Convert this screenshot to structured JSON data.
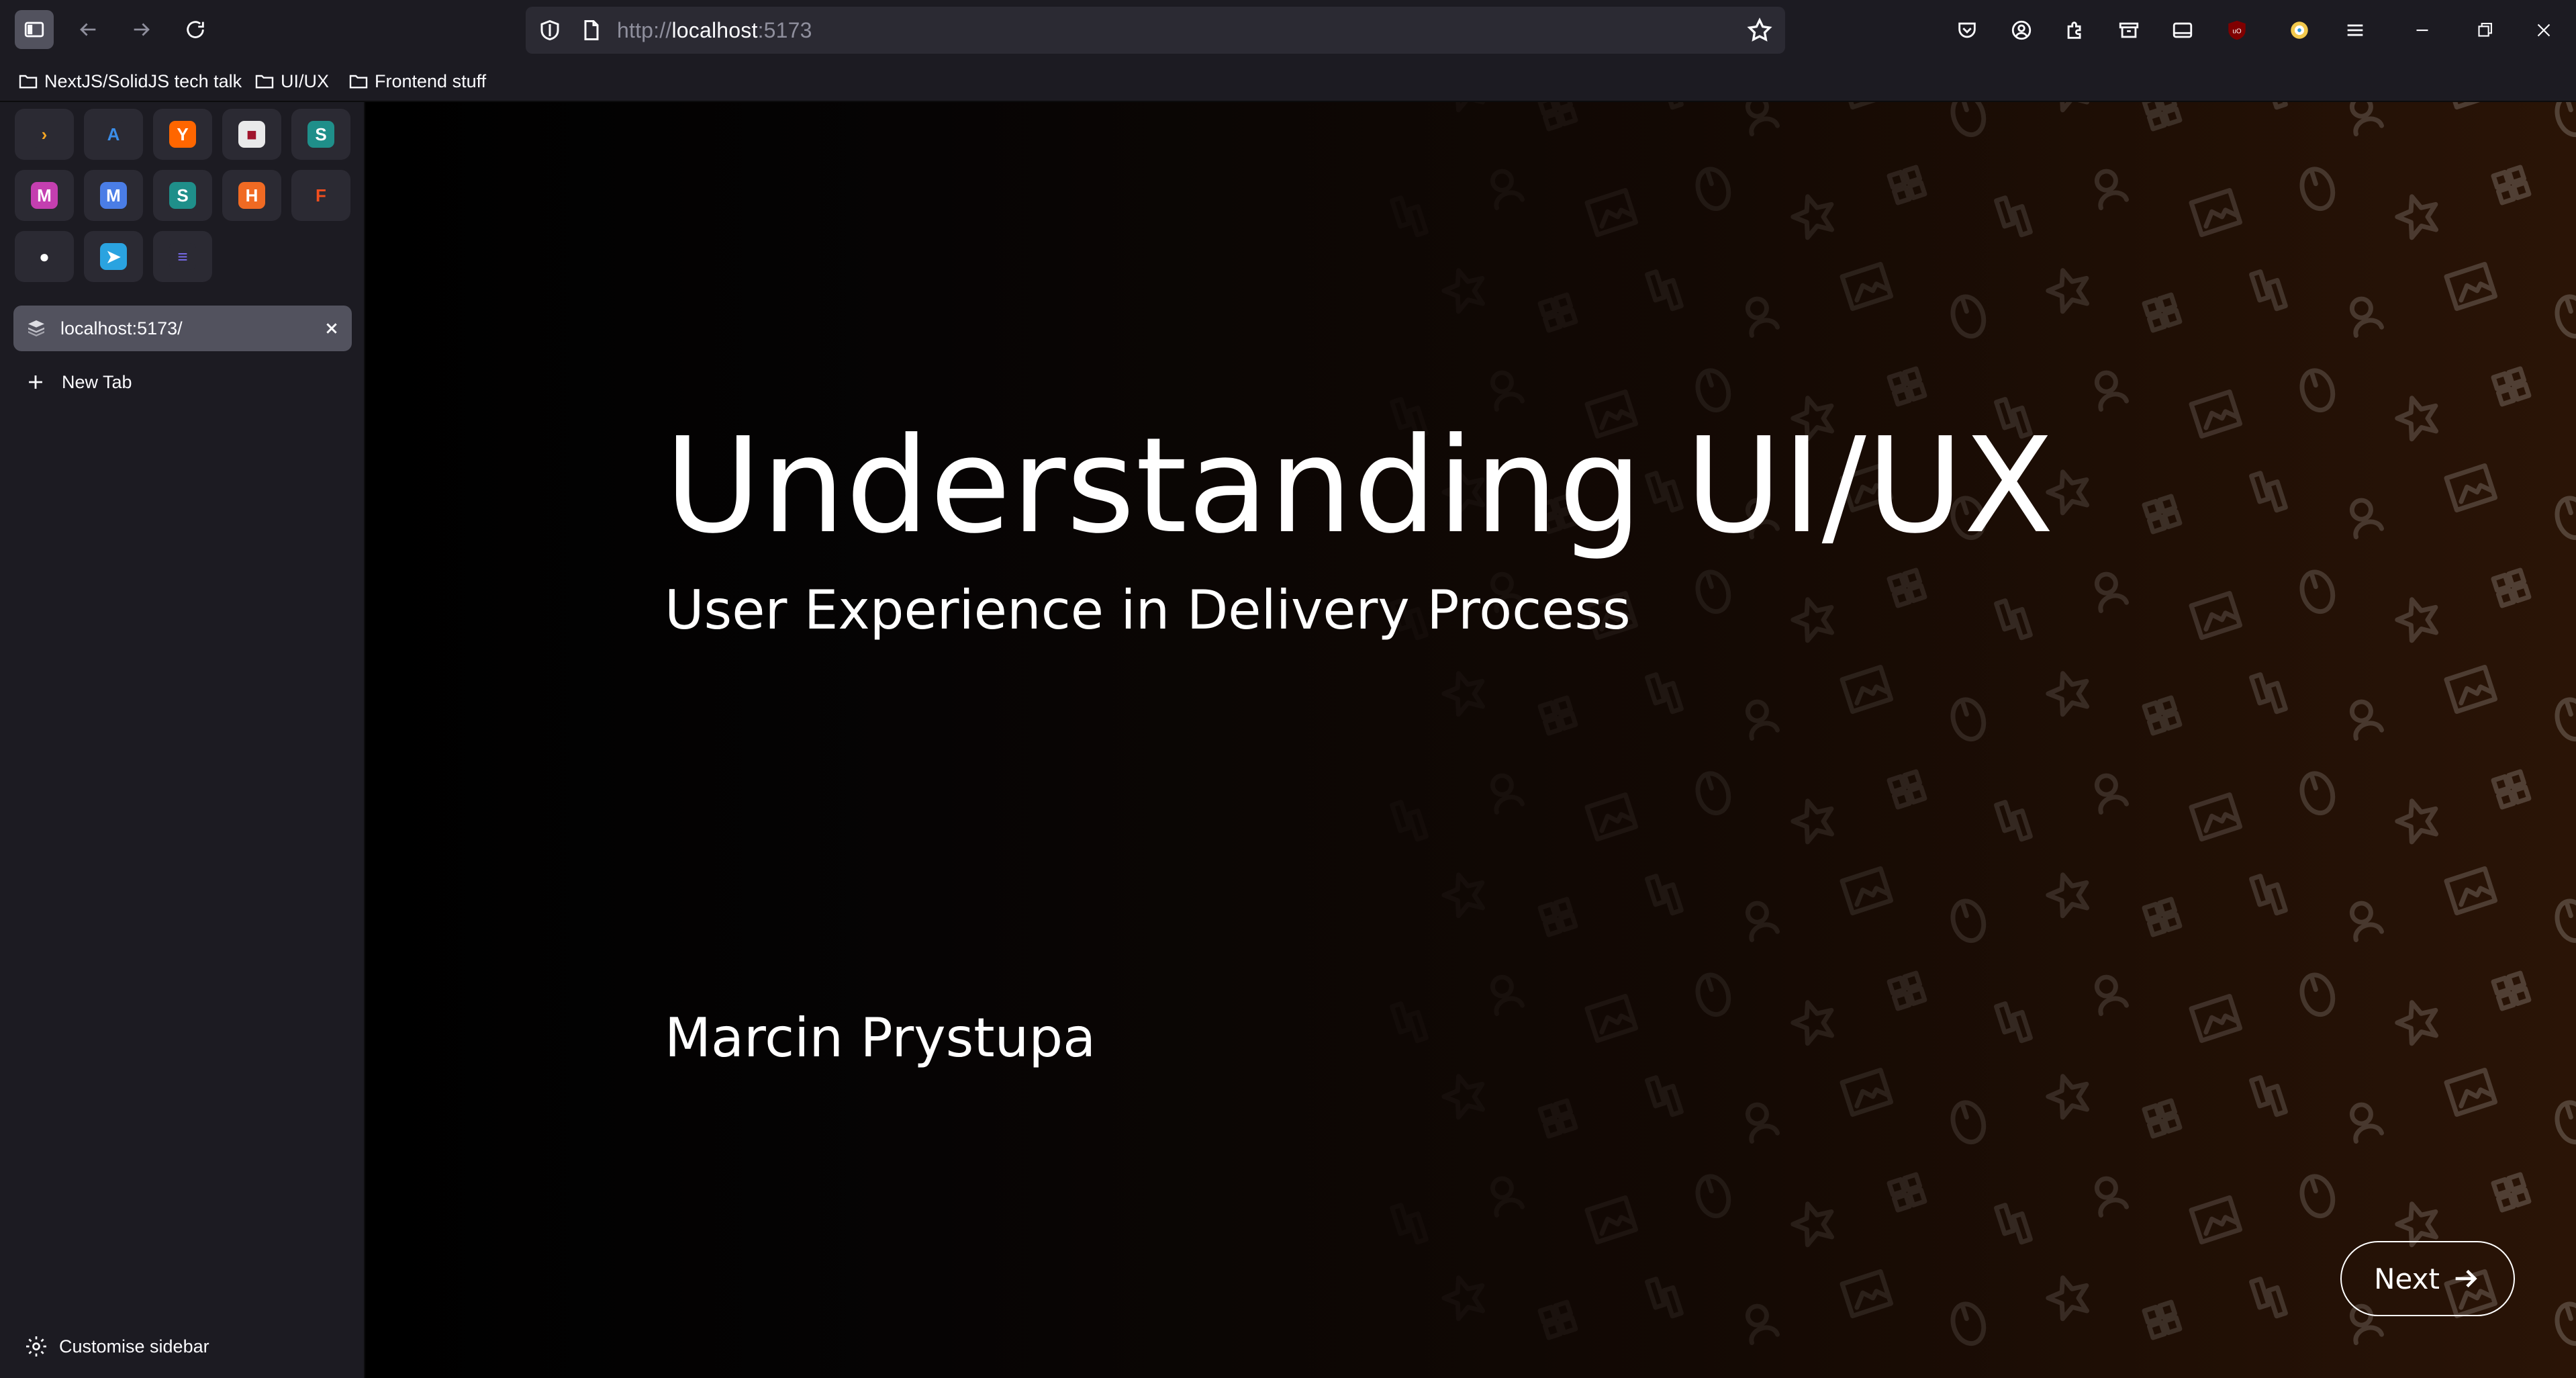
{
  "browser": {
    "url_prefix": "http://",
    "url_host": "localhost",
    "url_port": ":5173"
  },
  "bookmarks": [
    {
      "label": "NextJS/SolidJS tech talk"
    },
    {
      "label": "UI/UX"
    },
    {
      "label": "Frontend stuff"
    }
  ],
  "pinned_tabs": [
    {
      "icon": "code-app-icon",
      "glyph": "›",
      "color": "#2b2a33",
      "fg": "#f5a623"
    },
    {
      "icon": "azure-icon",
      "glyph": "A",
      "color": "#2b2a33",
      "fg": "#3b8de8"
    },
    {
      "icon": "ycombinator-icon",
      "glyph": "Y",
      "color": "#ff6600",
      "fg": "#ffffff"
    },
    {
      "icon": "save-app-icon",
      "glyph": "■",
      "color": "#e9e9ea",
      "fg": "#a0142c"
    },
    {
      "icon": "sharepoint-icon",
      "glyph": "S",
      "color": "#1f8f8a",
      "fg": "#ffffff"
    },
    {
      "icon": "mail-app-icon",
      "glyph": "M",
      "color": "#c43fb0",
      "fg": "#ffffff"
    },
    {
      "icon": "mastodon-icon",
      "glyph": "M",
      "color": "#4a7de6",
      "fg": "#ffffff"
    },
    {
      "icon": "sharepoint-icon-2",
      "glyph": "S",
      "color": "#1f8f8a",
      "fg": "#ffffff"
    },
    {
      "icon": "h-app-icon",
      "glyph": "H",
      "color": "#f06a23",
      "fg": "#ffffff"
    },
    {
      "icon": "figma-icon",
      "glyph": "F",
      "color": "#2b2a33",
      "fg": "#f24e1e"
    },
    {
      "icon": "github-icon",
      "glyph": "●",
      "color": "#2b2a33",
      "fg": "#ffffff"
    },
    {
      "icon": "telegram-icon",
      "glyph": "➤",
      "color": "#2aa3e0",
      "fg": "#ffffff"
    },
    {
      "icon": "linear-app-icon",
      "glyph": "≡",
      "color": "#2b2a33",
      "fg": "#7a6cf0"
    }
  ],
  "active_tab": {
    "title": "localhost:5173/"
  },
  "sidebar": {
    "new_tab_label": "New Tab",
    "customise_label": "Customise sidebar"
  },
  "slide": {
    "title": "Understanding UI/UX",
    "subtitle": "User Experience in Delivery Process",
    "author": "Marcin Prystupa",
    "next_label": "Next"
  }
}
